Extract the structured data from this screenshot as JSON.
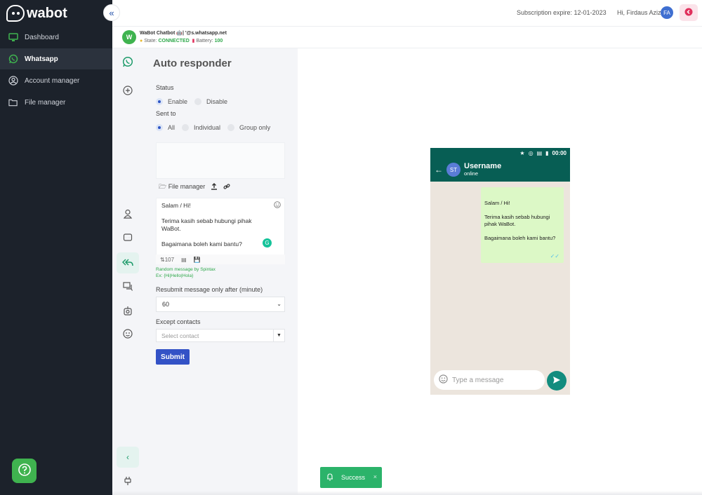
{
  "app": {
    "brand": "wabot"
  },
  "sidebar": {
    "items": [
      {
        "label": "Dashboard",
        "icon": "monitor-icon"
      },
      {
        "label": "Whatsapp",
        "icon": "whatsapp-icon",
        "active": true
      },
      {
        "label": "Account manager",
        "icon": "user-circle-icon"
      },
      {
        "label": "File manager",
        "icon": "folder-icon"
      }
    ]
  },
  "header": {
    "subscription": "Subscription expire: 12-01-2023",
    "greeting": "Hi, Firdaus Azizi",
    "avatar_initials": "FA"
  },
  "device": {
    "avatar_initials": "W",
    "name": "WaBot Chatbot 🤖| '@s.whatsapp.net",
    "state_label": "State:",
    "state_value": "CONNECTED",
    "battery_label": "Battery:",
    "battery_value": "100"
  },
  "form": {
    "title": "Auto responder",
    "status_label": "Status",
    "status_options": [
      "Enable",
      "Disable"
    ],
    "status_selected": "Enable",
    "sent_to_label": "Sent to",
    "sent_to_options": [
      "All",
      "Individual",
      "Group only"
    ],
    "sent_to_selected": "All",
    "file_manager_label": "File manager",
    "message_lines": [
      "Salam / Hi!",
      "Terima kasih sebab hubungi pihak WaBot.",
      "Bagaimana boleh kami bantu?"
    ],
    "char_count": "107",
    "spintax_note": "Random message by Spintax",
    "spintax_example": "Ex: {Hi|Hello|Hola}",
    "resubmit_label": "Resubmit message only after (minute)",
    "resubmit_value": "60",
    "except_label": "Except contacts",
    "except_placeholder": "Select contact",
    "submit_label": "Submit"
  },
  "phone": {
    "time": "00:00",
    "contact_initials": "ST",
    "contact_name": "Username",
    "contact_status": "online",
    "bubble_lines": [
      "Salam / Hi!",
      "Terima kasih sebab hubungi pihak WaBot.",
      "Bagaimana boleh kami bantu?"
    ],
    "input_placeholder": "Type a message"
  },
  "toast": {
    "text": "Success"
  },
  "colors": {
    "sidebar_bg": "#1c222b",
    "whatsapp_green": "#075e54",
    "accent_blue": "#3352c6",
    "success_green": "#2bb36a"
  }
}
